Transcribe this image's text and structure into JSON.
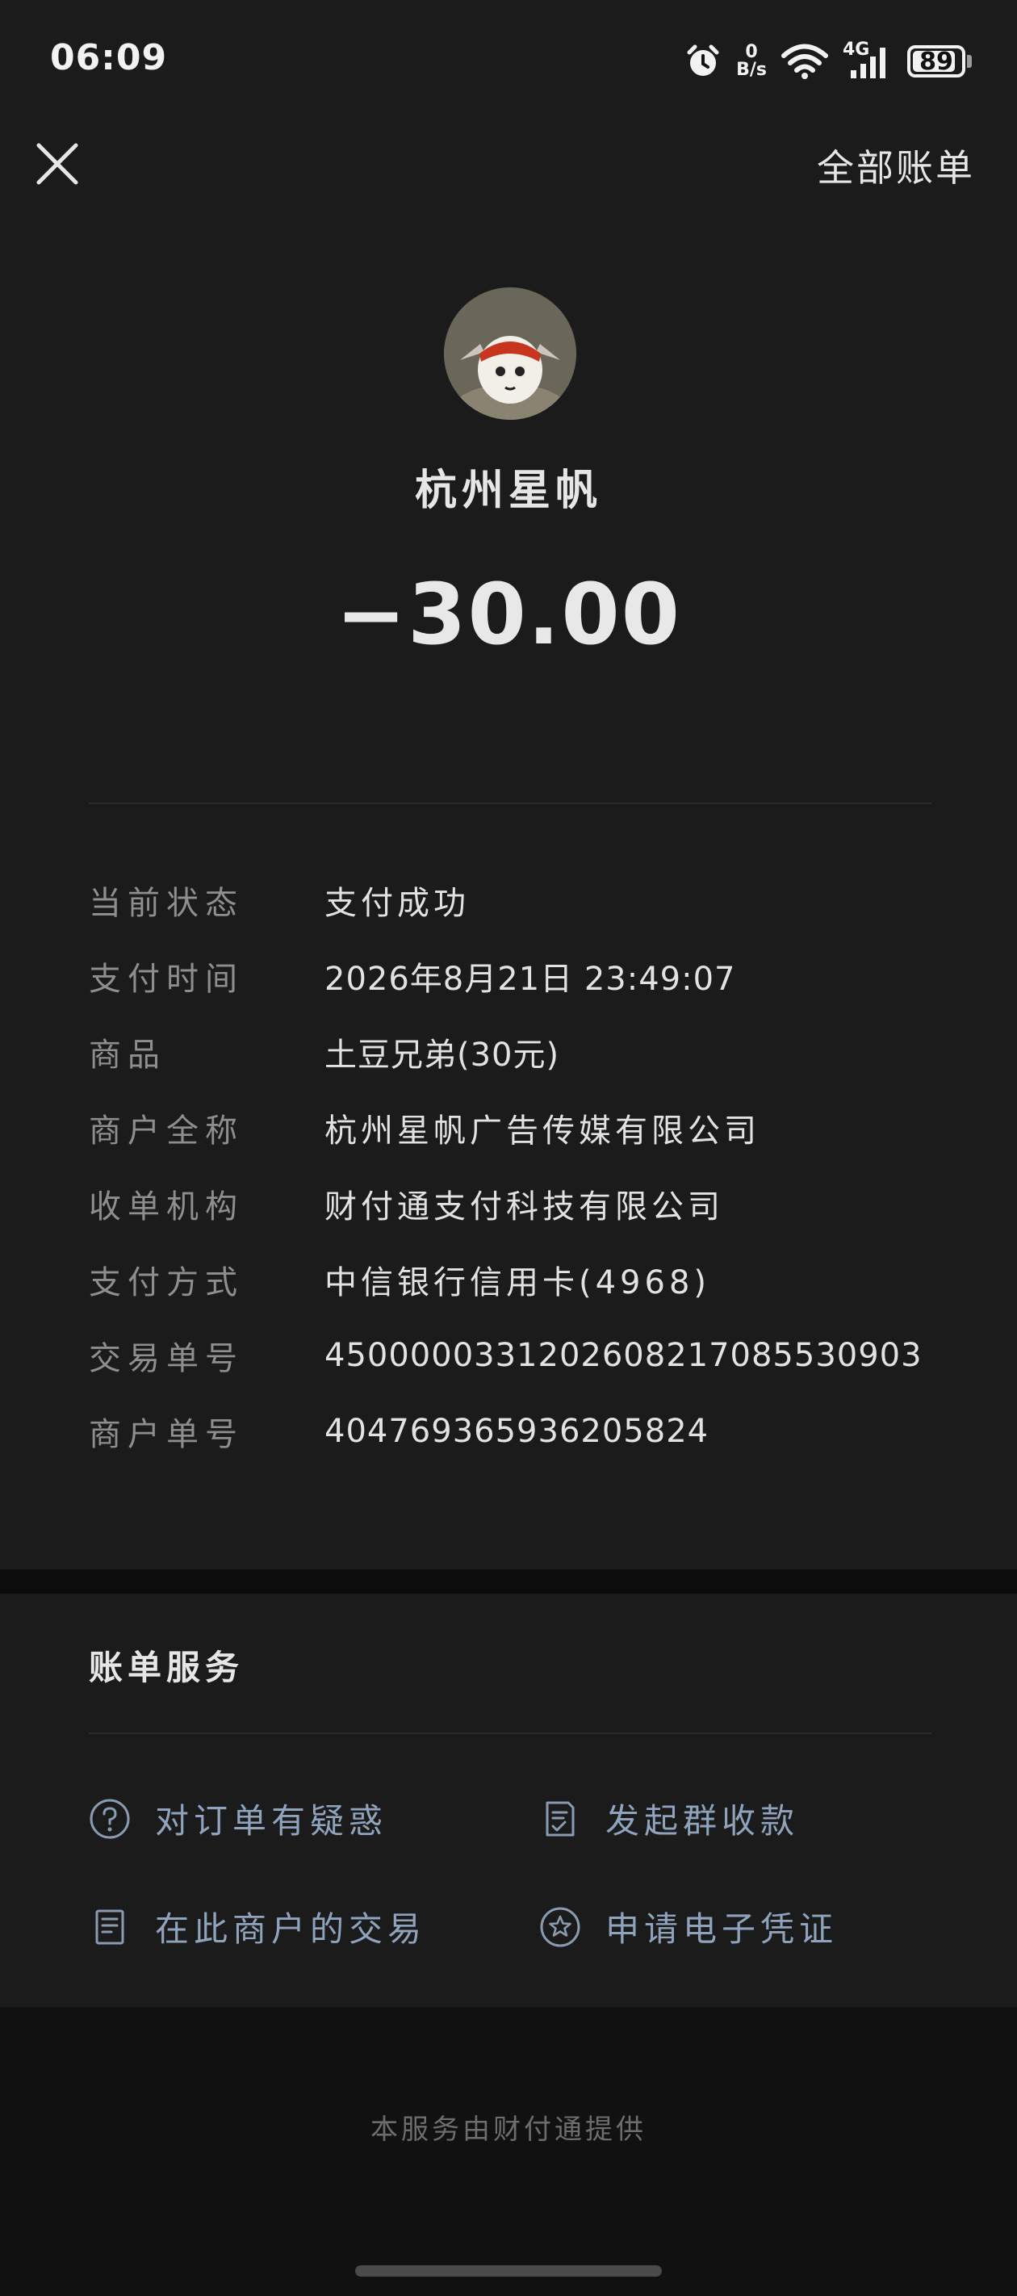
{
  "status_bar": {
    "time": "06:09",
    "net_speed_value": "0",
    "net_speed_unit": "B/s",
    "network_type": "4G",
    "battery": "89",
    "battery_level": 0.89,
    "icons": [
      "alarm-icon",
      "wifi-icon",
      "signal-icon",
      "battery-icon"
    ]
  },
  "header": {
    "close_icon": "close-icon",
    "all_bills_label": "全部账单"
  },
  "merchant": {
    "name": "杭州星帆",
    "amount": "−30.00"
  },
  "details": [
    {
      "label": "当前状态",
      "value": "支付成功"
    },
    {
      "label": "支付时间",
      "value": "2026年8月21日 23:49:07"
    },
    {
      "label": "商品",
      "value": "土豆兄弟(30元)"
    },
    {
      "label": "商户全称",
      "value": "杭州星帆广告传媒有限公司"
    },
    {
      "label": "收单机构",
      "value": "财付通支付科技有限公司"
    },
    {
      "label": "支付方式",
      "value": "中信银行信用卡(4968)"
    },
    {
      "label": "交易单号",
      "value": "4500000331202608217085530903"
    },
    {
      "label": "商户单号",
      "value": "404769365936205824"
    }
  ],
  "services": {
    "title": "账单服务",
    "items": [
      {
        "label": "对订单有疑惑",
        "icon": "question-circle-icon"
      },
      {
        "label": "发起群收款",
        "icon": "checklist-document-icon"
      },
      {
        "label": "在此商户的交易",
        "icon": "document-icon"
      },
      {
        "label": "申请电子凭证",
        "icon": "star-badge-icon"
      }
    ]
  },
  "footer": {
    "text": "本服务由财付通提供"
  },
  "colors": {
    "background": "#111111",
    "card": "#1b1b1b",
    "link": "#8fa3bd"
  }
}
